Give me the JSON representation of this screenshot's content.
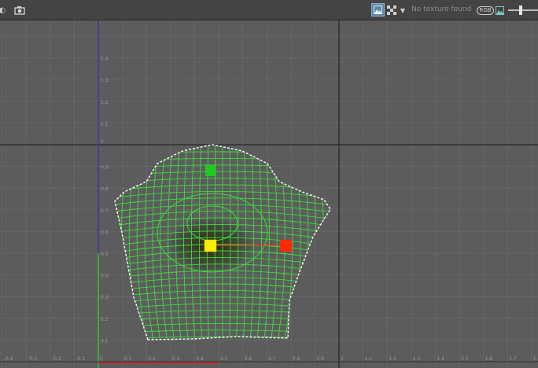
{
  "toolbar": {
    "texture_status": "No texture found",
    "rgb_label": "RGB",
    "channel_slider_value": 0.4
  },
  "uv_editor": {
    "grid_labels": {
      "v_top": [
        "1.4",
        "1.3",
        "1.2",
        "1.1",
        "1"
      ],
      "v_bottom": [
        "0.9",
        "0.8",
        "0.7",
        "0.6",
        "0.5",
        "0.4",
        "0.3",
        "0.2",
        "0.1"
      ],
      "u_negative": [
        "-0.4",
        "-0.3",
        "-0.2",
        "-0.1"
      ],
      "u_zero": "0",
      "u_unit": [
        "0.1",
        "0.2",
        "0.3",
        "0.4",
        "0.5",
        "0.6",
        "0.7",
        "0.8",
        "0.9"
      ],
      "u_one": "1",
      "u_above": [
        "1.1",
        "1.2",
        "1.3",
        "1.4",
        "1.5",
        "1.6",
        "1.7",
        "1.8"
      ]
    },
    "colors": {
      "background": "#5c5c5c",
      "uv_mesh": "#3ddc3d",
      "border_edges": "#ffffff",
      "u_axis": "#c03030",
      "v_axis": "#3a3aa0",
      "v_axis_lower": "#35c035",
      "pin_yellow": "#ffee00",
      "pin_red": "#ff2a00",
      "pin_green": "#22c822"
    }
  }
}
